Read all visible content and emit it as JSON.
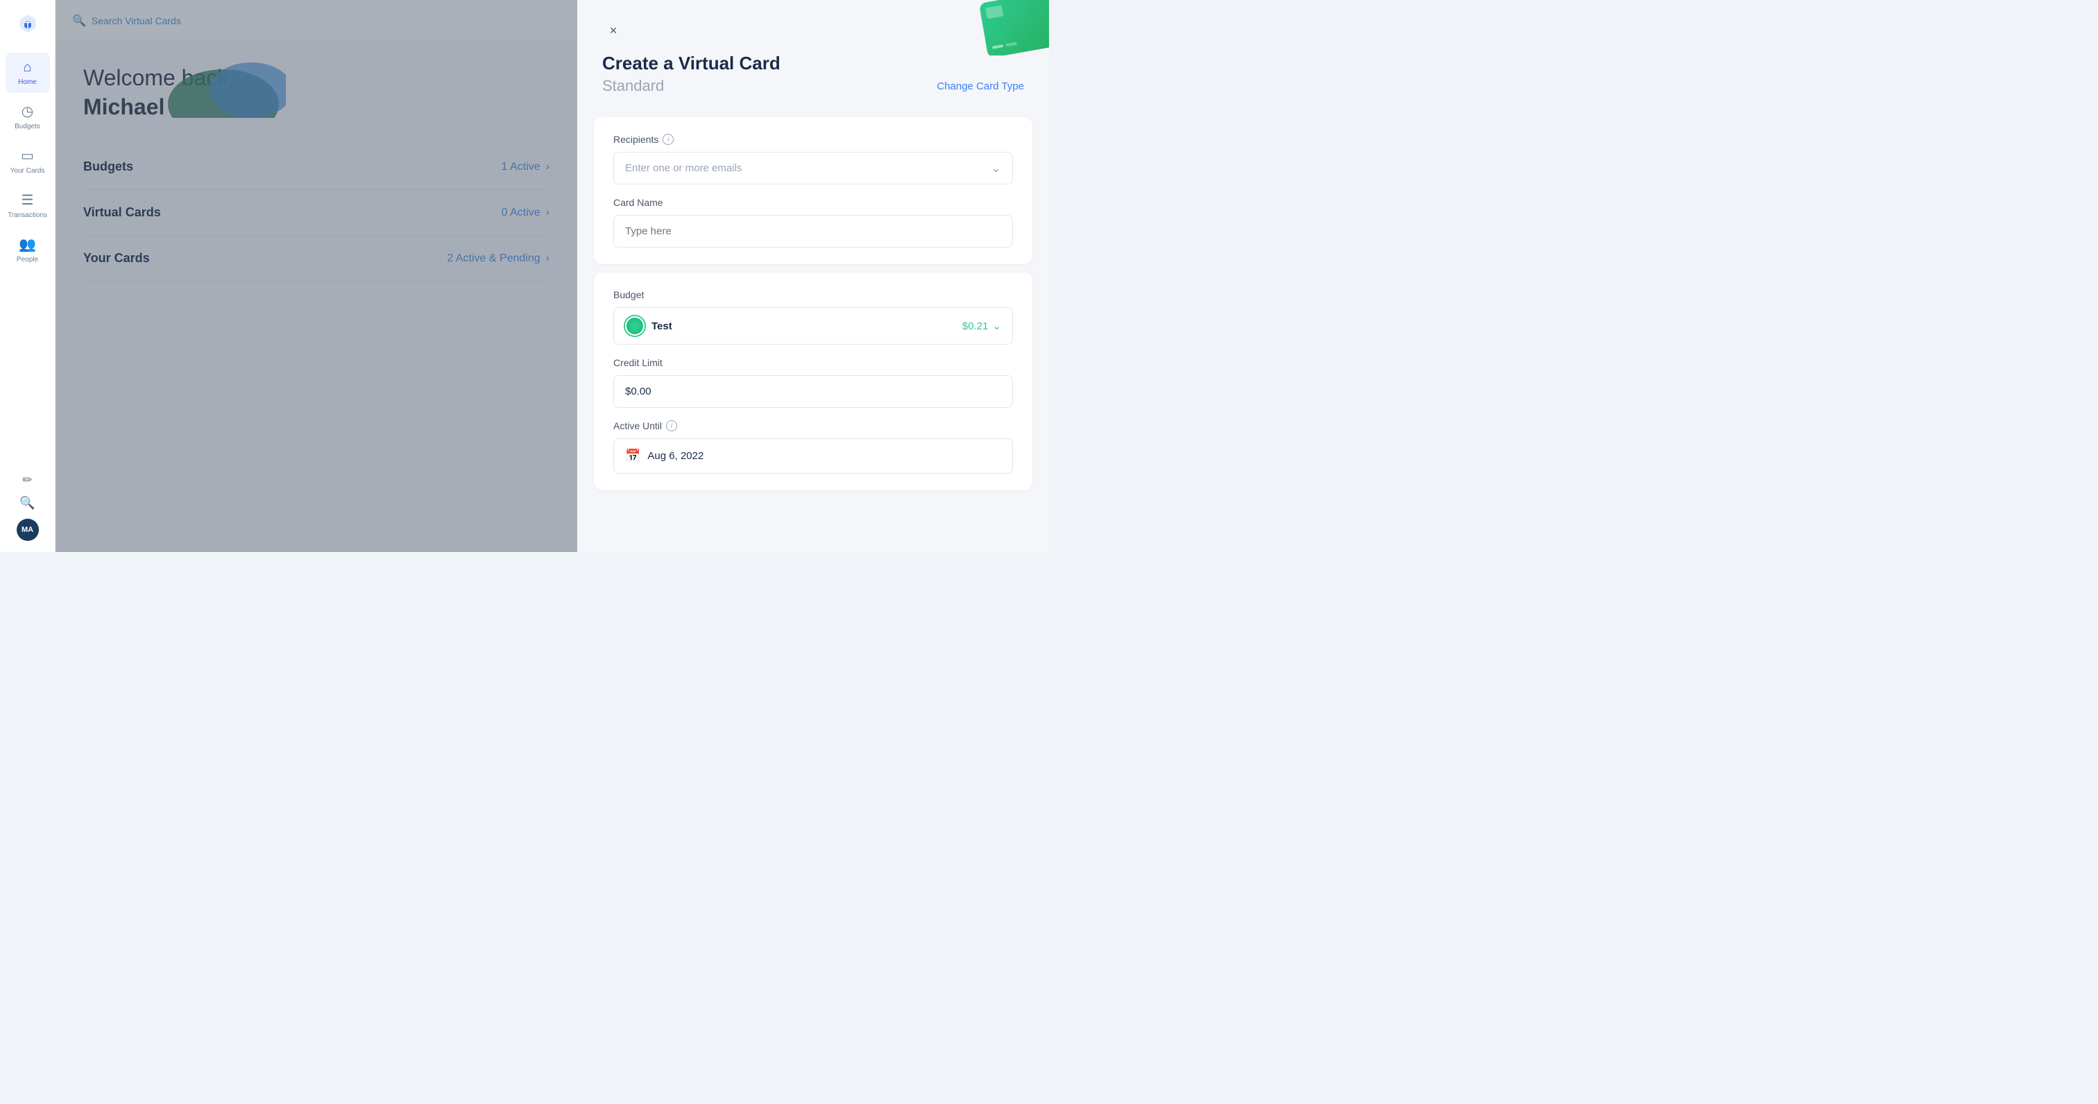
{
  "sidebar": {
    "logo_text": "⟨⟩",
    "items": [
      {
        "id": "home",
        "label": "Home",
        "icon": "⌂",
        "active": true
      },
      {
        "id": "budgets",
        "label": "Budgets",
        "icon": "◷",
        "active": false
      },
      {
        "id": "your-cards",
        "label": "Your Cards",
        "icon": "▭",
        "active": false
      },
      {
        "id": "transactions",
        "label": "Transactions",
        "icon": "≡",
        "active": false
      },
      {
        "id": "people",
        "label": "People",
        "icon": "👥",
        "active": false
      }
    ],
    "bottom": [
      {
        "id": "edit",
        "icon": "✏"
      },
      {
        "id": "search",
        "icon": "🔍"
      }
    ],
    "avatar_label": "MA"
  },
  "topbar": {
    "search_placeholder": "Search Virtual Cards",
    "search_icon": "search-icon"
  },
  "main": {
    "welcome_line1": "Welcome back,",
    "welcome_line2": "Michael",
    "rows": [
      {
        "id": "budgets",
        "label": "Budgets",
        "status": "1 Active",
        "arrow": ">"
      },
      {
        "id": "virtual-cards",
        "label": "Virtual Cards",
        "status": "0 Active",
        "arrow": ">"
      },
      {
        "id": "your-cards",
        "label": "Your Cards",
        "status": "2 Active & Pending",
        "arrow": ">"
      }
    ]
  },
  "drawer": {
    "close_label": "×",
    "title": "Create a Virtual Card",
    "subtitle": "Standard",
    "change_card_type_label": "Change Card Type",
    "sections": {
      "recipients": {
        "label": "Recipients",
        "placeholder": "Enter one or more emails",
        "has_info": true,
        "has_dropdown": true
      },
      "card_name": {
        "label": "Card Name",
        "placeholder": "Type here"
      },
      "budget": {
        "label": "Budget",
        "name": "Test",
        "amount": "$0.21"
      },
      "credit_limit": {
        "label": "Credit Limit",
        "value": "$0.00"
      },
      "active_until": {
        "label": "Active Until",
        "has_info": true,
        "date": "Aug 6, 2022"
      }
    }
  }
}
